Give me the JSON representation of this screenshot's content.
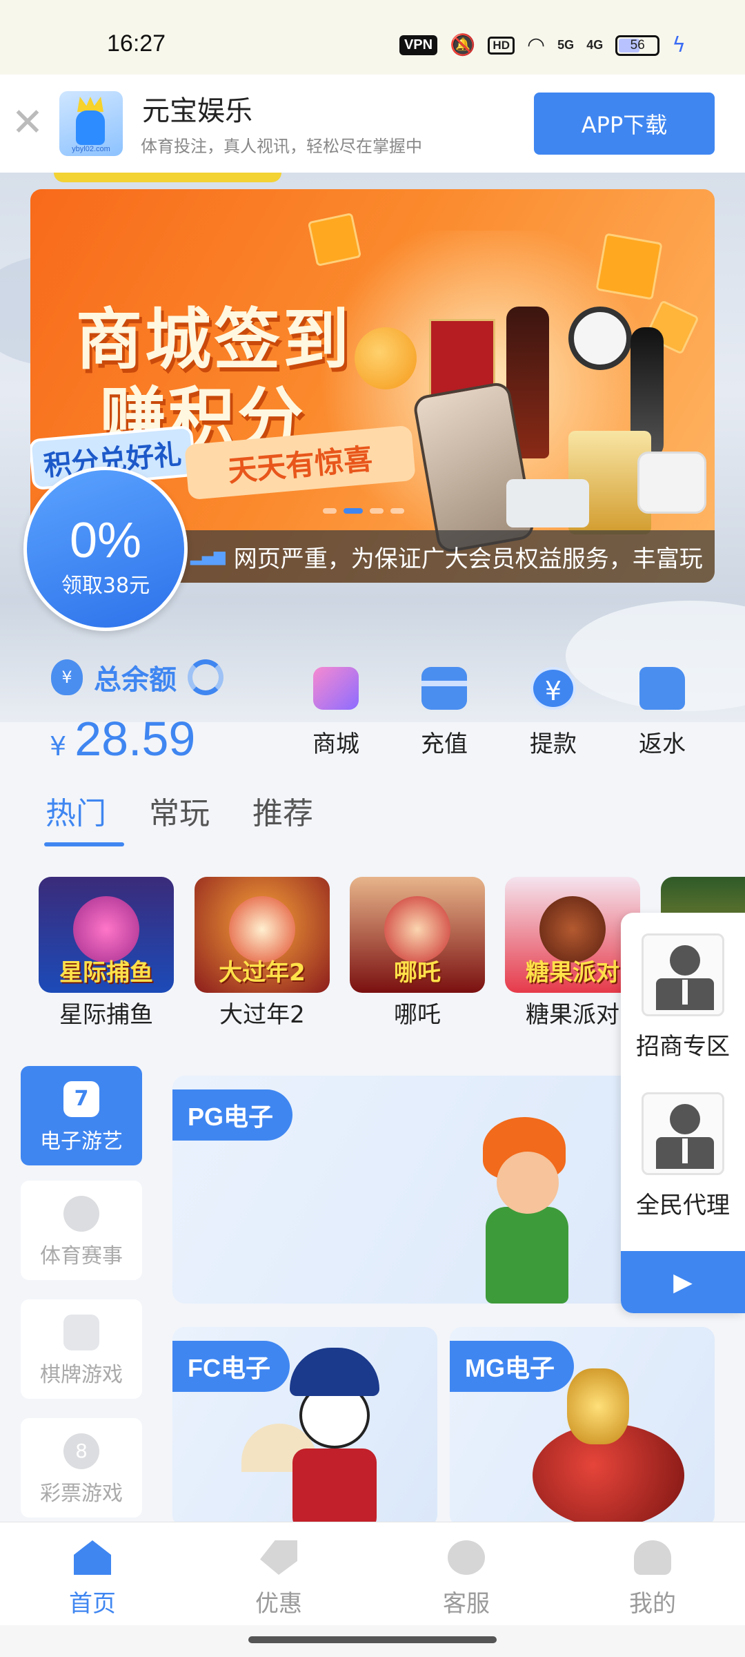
{
  "status_bar": {
    "time": "16:27",
    "vpn": "VPN",
    "hd": "HD",
    "signal_5g": "5G",
    "signal_4g": "4G",
    "battery": "56"
  },
  "app_banner": {
    "logo_domain": "ybyl02.com",
    "name": "元宝娱乐",
    "description": "体育投注，真人视讯，轻松尽在掌握中",
    "download_label": "APP下载"
  },
  "promo_banner": {
    "title_line1": "商城签到",
    "title_line2": "赚积分",
    "tag_blue": "积分兑好礼",
    "tag_orange": "天天有惊喜",
    "marquee": "网页严重，为保证广大会员权益服务，丰富玩"
  },
  "bonus": {
    "percent": "0%",
    "label": "领取38元"
  },
  "wallet": {
    "label": "总余额",
    "currency": "¥",
    "amount": "28.59",
    "actions": [
      {
        "label": "商城",
        "icon": "shop-icon"
      },
      {
        "label": "充值",
        "icon": "card-icon"
      },
      {
        "label": "提款",
        "icon": "yen-icon"
      },
      {
        "label": "返水",
        "icon": "wallet-icon"
      }
    ]
  },
  "tabs": [
    {
      "label": "热门",
      "active": true
    },
    {
      "label": "常玩",
      "active": false
    },
    {
      "label": "推荐",
      "active": false
    }
  ],
  "hot_games": [
    {
      "name": "星际捕鱼",
      "thumb_text": "星际捕鱼"
    },
    {
      "name": "大过年2",
      "thumb_text": "大过年2"
    },
    {
      "name": "哪吒",
      "thumb_text": "哪吒"
    },
    {
      "name": "糖果派对",
      "thumb_text": "糖果派对"
    }
  ],
  "categories": [
    {
      "label": "电子游艺",
      "icon": "slot-7-icon",
      "active": true,
      "glyph": "7"
    },
    {
      "label": "体育赛事",
      "icon": "soccer-ball-icon",
      "active": false
    },
    {
      "label": "棋牌游戏",
      "icon": "playing-card-icon",
      "active": false
    },
    {
      "label": "彩票游戏",
      "icon": "lottery-ball-icon",
      "active": false,
      "glyph": "8"
    }
  ],
  "providers": [
    {
      "tag": "PG电子"
    },
    {
      "tag": "FC电子"
    },
    {
      "tag": "MG电子"
    }
  ],
  "floating_panel": {
    "items": [
      {
        "label": "招商专区"
      },
      {
        "label": "全民代理"
      }
    ],
    "arrow": "▶"
  },
  "bottom_nav": [
    {
      "label": "首页",
      "active": true
    },
    {
      "label": "优惠",
      "active": false
    },
    {
      "label": "客服",
      "active": false
    },
    {
      "label": "我的",
      "active": false
    }
  ],
  "colors": {
    "accent": "#3f86f1",
    "banner_orange": "#f86a1a"
  }
}
